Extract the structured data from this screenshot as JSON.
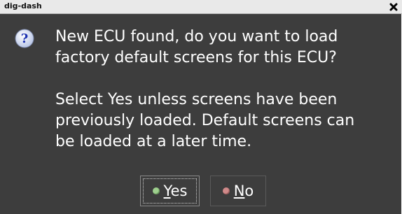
{
  "window": {
    "title": "dig-dash",
    "close_glyph": "✖"
  },
  "dialog": {
    "icon": "question-icon",
    "message_line1": "New ECU found, do you want to load",
    "message_line2": "factory default screens for this ECU?",
    "message_line3": "Select Yes unless screens have been",
    "message_line4": "previously loaded.  Default screens can",
    "message_line5": "be loaded at a later time."
  },
  "buttons": {
    "yes": {
      "mnemonic": "Y",
      "rest": "es",
      "indicator_color": "#9ecf8e"
    },
    "no": {
      "mnemonic": "N",
      "rest": "o",
      "indicator_color": "#d08a8a"
    }
  }
}
